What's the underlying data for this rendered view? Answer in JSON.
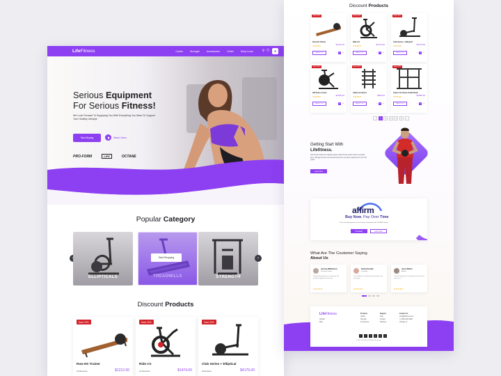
{
  "brand": {
    "name_bold": "Life",
    "name_light": "Fitness"
  },
  "nav": {
    "links": [
      "Cardio",
      "Strength",
      "Accessories",
      "Outlet",
      "Shop Local"
    ]
  },
  "hero": {
    "title_line1_light": "Serious ",
    "title_line1_bold": "Equipment",
    "title_line2_light": "For Serious ",
    "title_line2_bold": "Fitness!",
    "subtitle": "We Look Forward To Supplying You With Everything You Need To Support Your Healthy Lifestyle",
    "shop_button": "Start Buying",
    "watch_button": "Watch Video",
    "brands": [
      "PRO-FORM",
      "LIFE",
      "OCTANE"
    ]
  },
  "popular": {
    "title_light": "Popular ",
    "title_bold": "Category",
    "categories": [
      "ELLIPTICALS",
      "TREADMILLS",
      "STRENGTH"
    ],
    "shop_now": "Start Shopping"
  },
  "discount": {
    "title_light": "Discount ",
    "title_bold": "Products",
    "badge": "Save 20%",
    "products": [
      {
        "name": "Row HX Trainer",
        "reviews": "15 Reviews",
        "price": "$1212.00"
      },
      {
        "name": "Ride CX",
        "reviews": "12 Reviews",
        "price": "$1474.00"
      },
      {
        "name": "Club Series + Elliptical",
        "reviews": "8 Reviews",
        "price": "$4175.00"
      }
    ]
  },
  "right_products": {
    "badge": "Save 20%",
    "stars": "★★★★★",
    "add_label": "Add to Cart",
    "items": [
      {
        "name": "Row HX Trainer",
        "price": "$1212.00"
      },
      {
        "name": "Ride CX",
        "price": "$1474.00"
      },
      {
        "name": "Club Series + Elliptical",
        "price": "$4175.00"
      },
      {
        "name": "IC8 Indoor Cycle",
        "price": "$2295.00"
      },
      {
        "name": "Cable Jet Series",
        "price": "$894.00"
      },
      {
        "name": "Cybex Jet Series Smith Rack",
        "price": "$2895.00"
      }
    ],
    "pages": [
      "‹",
      "1",
      "2",
      "3",
      "4",
      "5",
      "›"
    ]
  },
  "getting_started": {
    "title_light": "Getting Start With",
    "title_bold": "Lifefitness.",
    "text": "Life Fitness has been helping people make fitness a part of their everyday lives, offering the best commercial and home exercise equipment for over 50 years.",
    "button": "Learn More"
  },
  "affirm": {
    "logo": "affirm",
    "tag_bold1": "Buy Now",
    "tag_mid": ", Pay Over ",
    "tag_bold2": "Time",
    "small": "Easy monthly payments for your fitness equipment with 0% APR options",
    "button1": "Prequalify",
    "button2": "Learn More"
  },
  "testimonials": {
    "title_light": "What Are The Coutomer Saying",
    "title_bold": "About Us",
    "stars": "★★★★★",
    "items": [
      {
        "name": "Jessica Williamson",
        "role": "Personal Trainer",
        "text": "Great quality equipment, fast delivery and excellent support from the team."
      },
      {
        "name": "Emma Donald",
        "role": "Customer",
        "text": "The treadmill is amazing and fits perfectly in my home gym."
      },
      {
        "name": "Jesse Martin",
        "role": "Athlete",
        "text": "I use the strength rack every day, built to last and easy to use."
      }
    ]
  },
  "footer": {
    "logo_bold": "Life",
    "logo_light": "Fitness",
    "about": [
      "Support",
      "Blog"
    ],
    "col1": {
      "title": "Products",
      "items": [
        "Cardio",
        "Strength",
        "Accessories"
      ]
    },
    "col2": {
      "title": "Support",
      "items": [
        "Help",
        "Contact",
        "Warranty"
      ]
    },
    "col3": {
      "title": "Contact Us",
      "items": [
        "info@lifefitness.com",
        "+1 (800) 000-0000",
        "Chicago, IL"
      ]
    },
    "social": [
      "f",
      "t",
      "in",
      "ig",
      "yt",
      "p"
    ],
    "copyright": "© 2021 Life Fitness. All Rights Reserved."
  },
  "colors": {
    "accent": "#8d3ff2",
    "badge": "#d3232a",
    "dark": "#1c1c24"
  }
}
